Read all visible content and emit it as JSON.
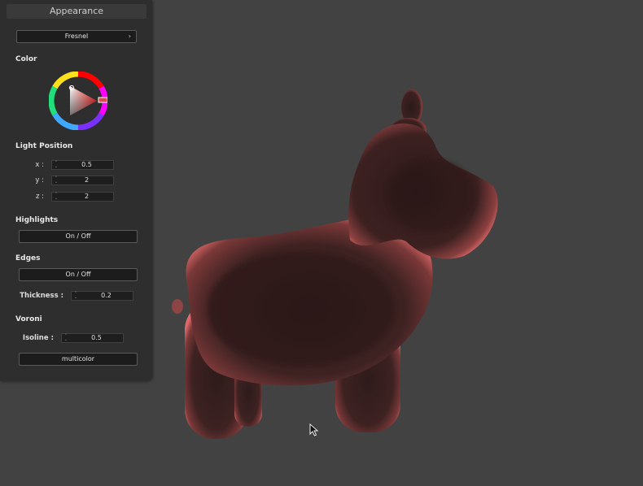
{
  "panel": {
    "title": "Appearance",
    "preset": {
      "label": "Fresnel",
      "arrow": "›"
    },
    "color": {
      "label": "Color",
      "selected_hex": "#d45a5a"
    },
    "light_position": {
      "label": "Light Position",
      "x": {
        "label": "x :",
        "value": "0.5"
      },
      "y": {
        "label": "y :",
        "value": "2"
      },
      "z": {
        "label": "z :",
        "value": "2"
      }
    },
    "highlights": {
      "label": "Highlights",
      "toggle": "On / Off"
    },
    "edges": {
      "label": "Edges",
      "toggle": "On / Off",
      "thickness": {
        "label": "Thickness :",
        "value": "0.2"
      }
    },
    "voronoi": {
      "label": "Voroni",
      "isoline": {
        "label": "Isoline :",
        "value": "0.5"
      },
      "mode_button": "multicolor"
    }
  },
  "viewport": {
    "background": "#424242",
    "model_color": "#d45a5a",
    "model": "3d-horse-toy"
  }
}
